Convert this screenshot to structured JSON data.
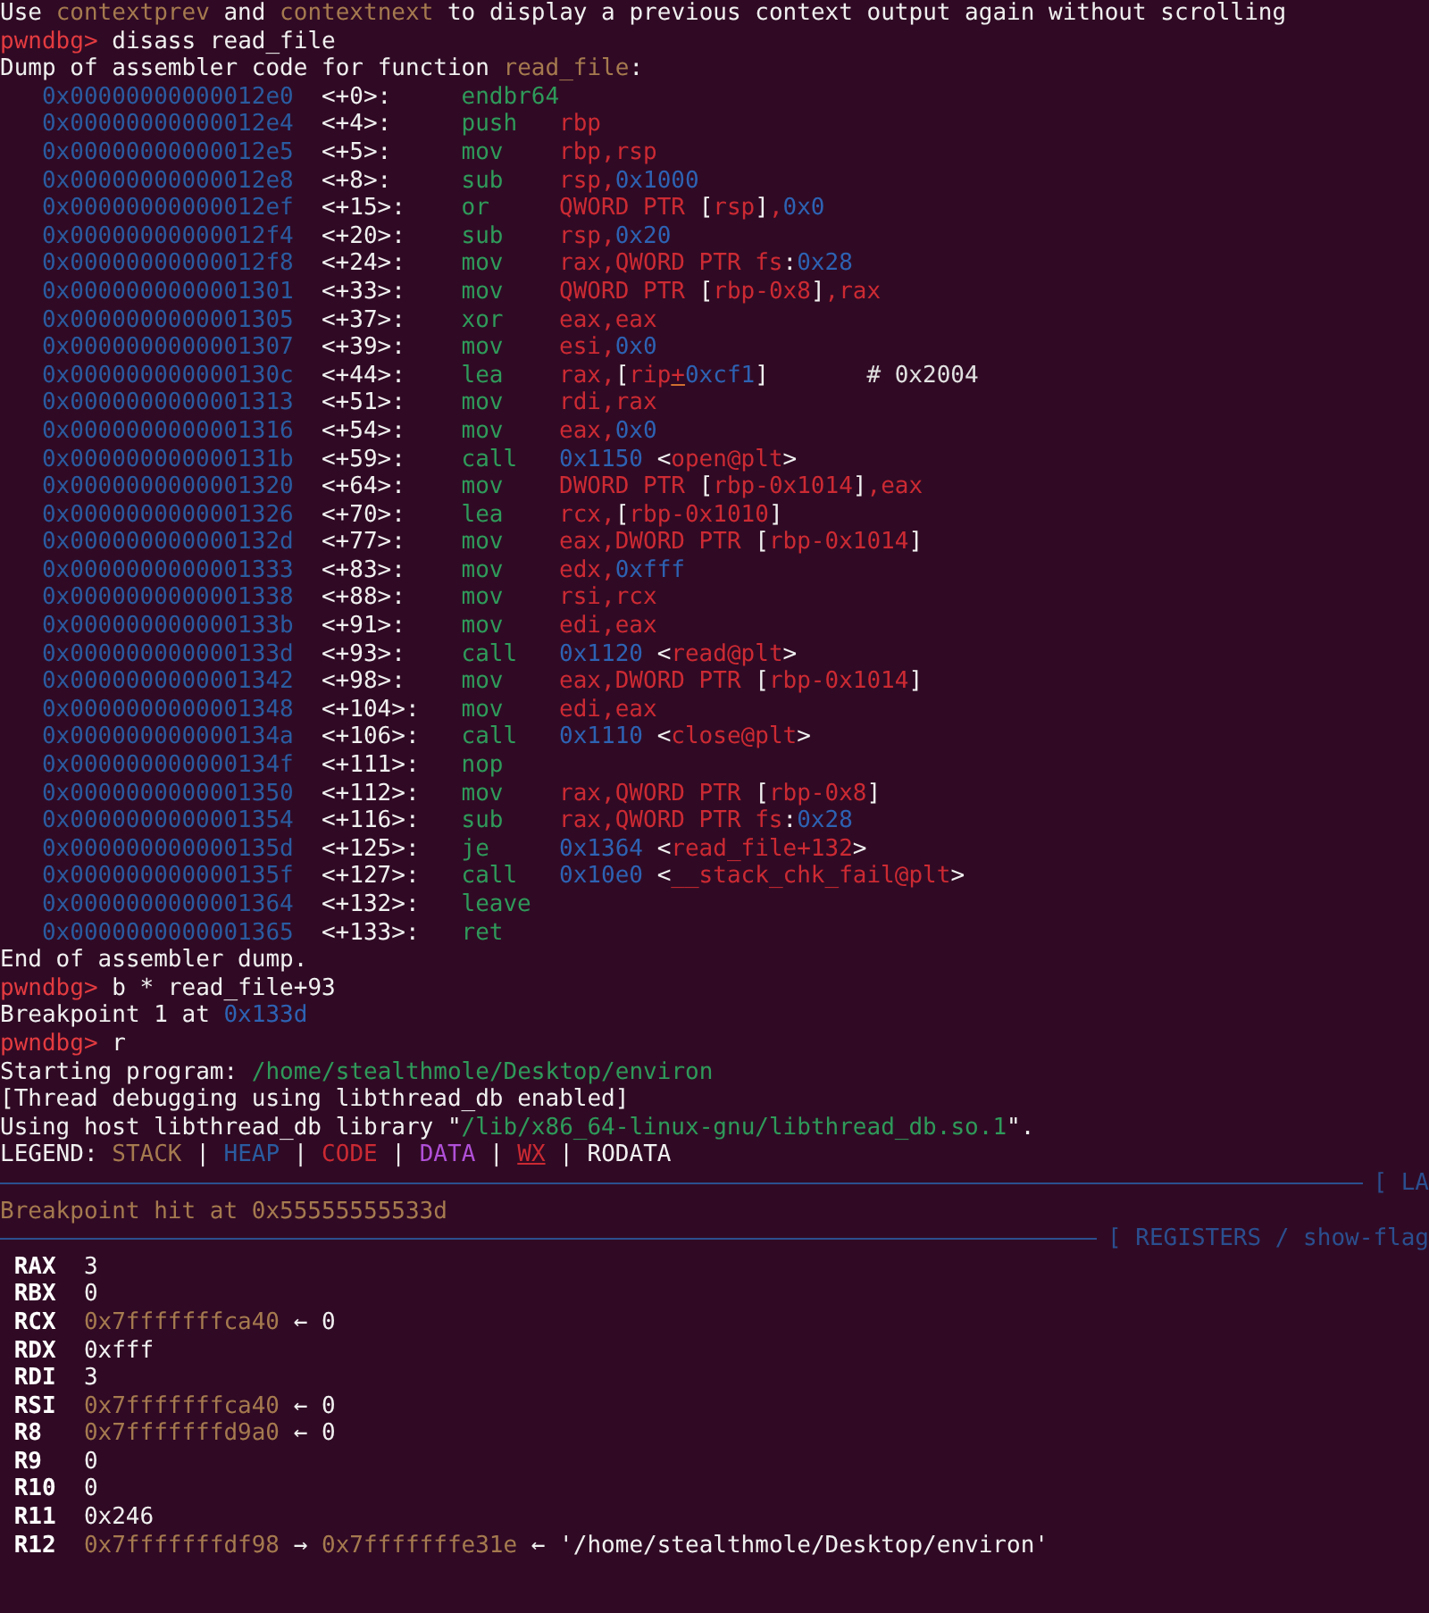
{
  "terminal": {
    "lines": [
      {
        "kind": "output",
        "parts": [
          {
            "text": "Use ",
            "kind": "text"
          },
          {
            "text": "contextprev",
            "kind": "pointer"
          },
          {
            "text": " and ",
            "kind": "text"
          },
          {
            "text": "contextnext",
            "kind": "pointer"
          },
          {
            "text": " to display a previous context output again without scrolling",
            "kind": "text"
          }
        ]
      },
      {
        "kind": "prompt",
        "parts": [
          {
            "text": "pwndbg>",
            "kind": "prompt"
          },
          {
            "text": " disass read_file",
            "kind": "text"
          }
        ]
      },
      {
        "kind": "output",
        "parts": [
          {
            "text": "Dump of assembler code for function ",
            "kind": "text"
          },
          {
            "text": "read_file",
            "kind": "pointer"
          },
          {
            "text": ":",
            "kind": "text"
          }
        ]
      },
      {
        "kind": "asm",
        "address": "0x00000000000012e0",
        "offset": "<+0>:",
        "mnemonic": "endbr64"
      },
      {
        "kind": "asm",
        "address": "0x00000000000012e4",
        "offset": "<+4>:",
        "mnemonic": "push",
        "operands": [
          {
            "text": "rbp",
            "kind": "register"
          }
        ]
      },
      {
        "kind": "asm",
        "address": "0x00000000000012e5",
        "offset": "<+5>:",
        "mnemonic": "mov",
        "operands": [
          {
            "text": "rbp,rsp",
            "kind": "register"
          }
        ]
      },
      {
        "kind": "asm",
        "address": "0x00000000000012e8",
        "offset": "<+8>:",
        "mnemonic": "sub",
        "operands": [
          {
            "text": "rsp,",
            "kind": "register"
          },
          {
            "text": "0x1000",
            "kind": "number"
          }
        ]
      },
      {
        "kind": "asm",
        "address": "0x00000000000012ef",
        "offset": "<+15>:",
        "mnemonic": "or",
        "operands": [
          {
            "text": "QWORD PTR ",
            "kind": "register"
          },
          {
            "text": "[",
            "kind": "text"
          },
          {
            "text": "rsp",
            "kind": "register"
          },
          {
            "text": "]",
            "kind": "text"
          },
          {
            "text": ",",
            "kind": "register"
          },
          {
            "text": "0x0",
            "kind": "number"
          }
        ]
      },
      {
        "kind": "asm",
        "address": "0x00000000000012f4",
        "offset": "<+20>:",
        "mnemonic": "sub",
        "operands": [
          {
            "text": "rsp,",
            "kind": "register"
          },
          {
            "text": "0x20",
            "kind": "number"
          }
        ]
      },
      {
        "kind": "asm",
        "address": "0x00000000000012f8",
        "offset": "<+24>:",
        "mnemonic": "mov",
        "operands": [
          {
            "text": "rax,QWORD PTR fs",
            "kind": "register"
          },
          {
            "text": ":",
            "kind": "text"
          },
          {
            "text": "0x28",
            "kind": "number"
          }
        ]
      },
      {
        "kind": "asm",
        "address": "0x0000000000001301",
        "offset": "<+33>:",
        "mnemonic": "mov",
        "operands": [
          {
            "text": "QWORD PTR ",
            "kind": "register"
          },
          {
            "text": "[",
            "kind": "text"
          },
          {
            "text": "rbp-0x8",
            "kind": "register"
          },
          {
            "text": "]",
            "kind": "text"
          },
          {
            "text": ",rax",
            "kind": "register"
          }
        ]
      },
      {
        "kind": "asm",
        "address": "0x0000000000001305",
        "offset": "<+37>:",
        "mnemonic": "xor",
        "operands": [
          {
            "text": "eax,eax",
            "kind": "register"
          }
        ]
      },
      {
        "kind": "asm",
        "address": "0x0000000000001307",
        "offset": "<+39>:",
        "mnemonic": "mov",
        "operands": [
          {
            "text": "esi,",
            "kind": "register"
          },
          {
            "text": "0x0",
            "kind": "number"
          }
        ]
      },
      {
        "kind": "asm",
        "address": "0x000000000000130c",
        "offset": "<+44>:",
        "mnemonic": "lea",
        "operands": [
          {
            "text": "rax,",
            "kind": "register"
          },
          {
            "text": "[",
            "kind": "text"
          },
          {
            "text": "rip",
            "kind": "register"
          },
          {
            "text": "+",
            "kind": "cursor"
          },
          {
            "text": "0xcf1",
            "kind": "number"
          },
          {
            "text": "]",
            "kind": "text"
          }
        ],
        "comment": "# 0x2004"
      },
      {
        "kind": "asm",
        "address": "0x0000000000001313",
        "offset": "<+51>:",
        "mnemonic": "mov",
        "operands": [
          {
            "text": "rdi,rax",
            "kind": "register"
          }
        ]
      },
      {
        "kind": "asm",
        "address": "0x0000000000001316",
        "offset": "<+54>:",
        "mnemonic": "mov",
        "operands": [
          {
            "text": "eax,",
            "kind": "register"
          },
          {
            "text": "0x0",
            "kind": "number"
          }
        ]
      },
      {
        "kind": "asm",
        "address": "0x000000000000131b",
        "offset": "<+59>:",
        "mnemonic": "call",
        "operands": [
          {
            "text": "0x1150",
            "kind": "number"
          },
          {
            "text": " <",
            "kind": "text"
          },
          {
            "text": "open@plt",
            "kind": "register"
          },
          {
            "text": ">",
            "kind": "text"
          }
        ]
      },
      {
        "kind": "asm",
        "address": "0x0000000000001320",
        "offset": "<+64>:",
        "mnemonic": "mov",
        "operands": [
          {
            "text": "DWORD PTR ",
            "kind": "register"
          },
          {
            "text": "[",
            "kind": "text"
          },
          {
            "text": "rbp-0x1014",
            "kind": "register"
          },
          {
            "text": "]",
            "kind": "text"
          },
          {
            "text": ",eax",
            "kind": "register"
          }
        ]
      },
      {
        "kind": "asm",
        "address": "0x0000000000001326",
        "offset": "<+70>:",
        "mnemonic": "lea",
        "operands": [
          {
            "text": "rcx,",
            "kind": "register"
          },
          {
            "text": "[",
            "kind": "text"
          },
          {
            "text": "rbp-0x1010",
            "kind": "register"
          },
          {
            "text": "]",
            "kind": "text"
          }
        ]
      },
      {
        "kind": "asm",
        "address": "0x000000000000132d",
        "offset": "<+77>:",
        "mnemonic": "mov",
        "operands": [
          {
            "text": "eax,DWORD PTR ",
            "kind": "register"
          },
          {
            "text": "[",
            "kind": "text"
          },
          {
            "text": "rbp-0x1014",
            "kind": "register"
          },
          {
            "text": "]",
            "kind": "text"
          }
        ]
      },
      {
        "kind": "asm",
        "address": "0x0000000000001333",
        "offset": "<+83>:",
        "mnemonic": "mov",
        "operands": [
          {
            "text": "edx,",
            "kind": "register"
          },
          {
            "text": "0xfff",
            "kind": "number"
          }
        ]
      },
      {
        "kind": "asm",
        "address": "0x0000000000001338",
        "offset": "<+88>:",
        "mnemonic": "mov",
        "operands": [
          {
            "text": "rsi,rcx",
            "kind": "register"
          }
        ]
      },
      {
        "kind": "asm",
        "address": "0x000000000000133b",
        "offset": "<+91>:",
        "mnemonic": "mov",
        "operands": [
          {
            "text": "edi,eax",
            "kind": "register"
          }
        ]
      },
      {
        "kind": "asm",
        "address": "0x000000000000133d",
        "offset": "<+93>:",
        "mnemonic": "call",
        "operands": [
          {
            "text": "0x1120",
            "kind": "number"
          },
          {
            "text": " <",
            "kind": "text"
          },
          {
            "text": "read@plt",
            "kind": "register"
          },
          {
            "text": ">",
            "kind": "text"
          }
        ]
      },
      {
        "kind": "asm",
        "address": "0x0000000000001342",
        "offset": "<+98>:",
        "mnemonic": "mov",
        "operands": [
          {
            "text": "eax,DWORD PTR ",
            "kind": "register"
          },
          {
            "text": "[",
            "kind": "text"
          },
          {
            "text": "rbp-0x1014",
            "kind": "register"
          },
          {
            "text": "]",
            "kind": "text"
          }
        ]
      },
      {
        "kind": "asm",
        "address": "0x0000000000001348",
        "offset": "<+104>:",
        "mnemonic": "mov",
        "operands": [
          {
            "text": "edi,eax",
            "kind": "register"
          }
        ]
      },
      {
        "kind": "asm",
        "address": "0x000000000000134a",
        "offset": "<+106>:",
        "mnemonic": "call",
        "operands": [
          {
            "text": "0x1110",
            "kind": "number"
          },
          {
            "text": " <",
            "kind": "text"
          },
          {
            "text": "close@plt",
            "kind": "register"
          },
          {
            "text": ">",
            "kind": "text"
          }
        ]
      },
      {
        "kind": "asm",
        "address": "0x000000000000134f",
        "offset": "<+111>:",
        "mnemonic": "nop"
      },
      {
        "kind": "asm",
        "address": "0x0000000000001350",
        "offset": "<+112>:",
        "mnemonic": "mov",
        "operands": [
          {
            "text": "rax,QWORD PTR ",
            "kind": "register"
          },
          {
            "text": "[",
            "kind": "text"
          },
          {
            "text": "rbp-0x8",
            "kind": "register"
          },
          {
            "text": "]",
            "kind": "text"
          }
        ]
      },
      {
        "kind": "asm",
        "address": "0x0000000000001354",
        "offset": "<+116>:",
        "mnemonic": "sub",
        "operands": [
          {
            "text": "rax,QWORD PTR fs",
            "kind": "register"
          },
          {
            "text": ":",
            "kind": "text"
          },
          {
            "text": "0x28",
            "kind": "number"
          }
        ]
      },
      {
        "kind": "asm",
        "address": "0x000000000000135d",
        "offset": "<+125>:",
        "mnemonic": "je",
        "operands": [
          {
            "text": "0x1364",
            "kind": "number"
          },
          {
            "text": " <",
            "kind": "text"
          },
          {
            "text": "read_file+132",
            "kind": "register"
          },
          {
            "text": ">",
            "kind": "text"
          }
        ]
      },
      {
        "kind": "asm",
        "address": "0x000000000000135f",
        "offset": "<+127>:",
        "mnemonic": "call",
        "operands": [
          {
            "text": "0x10e0",
            "kind": "number"
          },
          {
            "text": " <",
            "kind": "text"
          },
          {
            "text": "__stack_chk_fail@plt",
            "kind": "register"
          },
          {
            "text": ">",
            "kind": "text"
          }
        ]
      },
      {
        "kind": "asm",
        "address": "0x0000000000001364",
        "offset": "<+132>:",
        "mnemonic": "leave"
      },
      {
        "kind": "asm",
        "address": "0x0000000000001365",
        "offset": "<+133>:",
        "mnemonic": "ret"
      },
      {
        "kind": "output",
        "parts": [
          {
            "text": "End of assembler dump.",
            "kind": "text"
          }
        ]
      },
      {
        "kind": "prompt",
        "parts": [
          {
            "text": "pwndbg>",
            "kind": "prompt"
          },
          {
            "text": " b * read_file+93",
            "kind": "text"
          }
        ]
      },
      {
        "kind": "output",
        "parts": [
          {
            "text": "Breakpoint 1 at ",
            "kind": "text"
          },
          {
            "text": "0x133d",
            "kind": "number"
          }
        ]
      },
      {
        "kind": "prompt",
        "parts": [
          {
            "text": "pwndbg>",
            "kind": "prompt"
          },
          {
            "text": " r",
            "kind": "text"
          }
        ]
      },
      {
        "kind": "output",
        "parts": [
          {
            "text": "Starting program: ",
            "kind": "text"
          },
          {
            "text": "/home/stealthmole/Desktop/environ",
            "kind": "path"
          }
        ]
      },
      {
        "kind": "output",
        "parts": [
          {
            "text": "[Thread debugging using libthread_db enabled]",
            "kind": "text"
          }
        ]
      },
      {
        "kind": "output",
        "parts": [
          {
            "text": "Using host libthread_db library \"",
            "kind": "text"
          },
          {
            "text": "/lib/x86_64-linux-gnu/libthread_db.so.1",
            "kind": "path"
          },
          {
            "text": "\".",
            "kind": "text"
          }
        ]
      },
      {
        "kind": "output",
        "parts": [
          {
            "text": "LEGEND: ",
            "kind": "text"
          },
          {
            "text": "STACK",
            "kind": "pointer"
          },
          {
            "text": " | ",
            "kind": "text"
          },
          {
            "text": "HEAP",
            "kind": "heap"
          },
          {
            "text": " | ",
            "kind": "text"
          },
          {
            "text": "CODE",
            "kind": "register"
          },
          {
            "text": " | ",
            "kind": "text"
          },
          {
            "text": "DATA",
            "kind": "data"
          },
          {
            "text": " | ",
            "kind": "text"
          },
          {
            "text": "WX",
            "kind": "writable"
          },
          {
            "text": " | RODATA",
            "kind": "text"
          }
        ]
      },
      {
        "kind": "rule",
        "label": "[ LA"
      },
      {
        "kind": "output",
        "parts": [
          {
            "text": "Breakpoint hit at 0x55555555533d",
            "kind": "pointer"
          }
        ]
      },
      {
        "kind": "rule",
        "label": "[ REGISTERS / show-flag"
      },
      {
        "kind": "register",
        "name": "RAX",
        "parts": [
          {
            "text": "3",
            "kind": "text"
          }
        ]
      },
      {
        "kind": "register",
        "name": "RBX",
        "parts": [
          {
            "text": "0",
            "kind": "text"
          }
        ]
      },
      {
        "kind": "register",
        "name": "RCX",
        "parts": [
          {
            "text": "0x7fffffffca40",
            "kind": "pointer"
          },
          {
            "text": " ← 0",
            "kind": "text"
          }
        ]
      },
      {
        "kind": "register",
        "name": "RDX",
        "parts": [
          {
            "text": "0xfff",
            "kind": "text"
          }
        ]
      },
      {
        "kind": "register",
        "name": "RDI",
        "parts": [
          {
            "text": "3",
            "kind": "text"
          }
        ]
      },
      {
        "kind": "register",
        "name": "RSI",
        "parts": [
          {
            "text": "0x7fffffffca40",
            "kind": "pointer"
          },
          {
            "text": " ← 0",
            "kind": "text"
          }
        ]
      },
      {
        "kind": "register",
        "name": "R8",
        "parts": [
          {
            "text": "0x7fffffffd9a0",
            "kind": "pointer"
          },
          {
            "text": " ← 0",
            "kind": "text"
          }
        ]
      },
      {
        "kind": "register",
        "name": "R9",
        "parts": [
          {
            "text": "0",
            "kind": "text"
          }
        ]
      },
      {
        "kind": "register",
        "name": "R10",
        "parts": [
          {
            "text": "0",
            "kind": "text"
          }
        ]
      },
      {
        "kind": "register",
        "name": "R11",
        "parts": [
          {
            "text": "0x246",
            "kind": "text"
          }
        ]
      },
      {
        "kind": "register",
        "name": "R12",
        "parts": [
          {
            "text": "0x7fffffffdf98",
            "kind": "pointer"
          },
          {
            "text": " → ",
            "kind": "text"
          },
          {
            "text": "0x7fffffffe31e",
            "kind": "pointer"
          },
          {
            "text": " ← '/home/stealthmole/Desktop/environ'",
            "kind": "text"
          }
        ]
      }
    ]
  }
}
